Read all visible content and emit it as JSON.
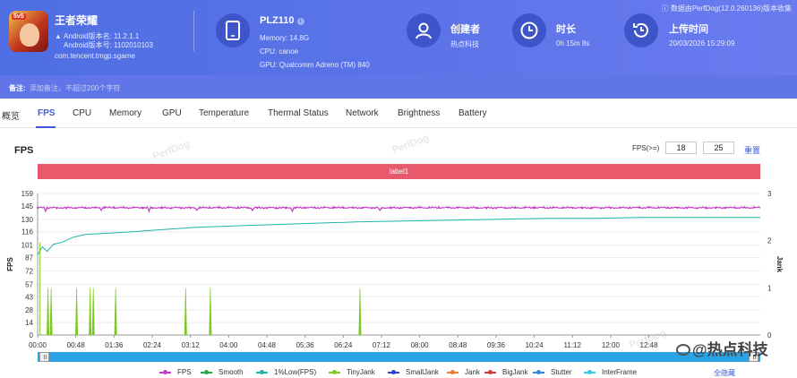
{
  "header": {
    "app": {
      "name": "王者荣耀",
      "badge": "5v5",
      "version_line": "Android版本名: 11.2.1.1",
      "code_line": "Android版本号: 1102010103",
      "package": "com.tencent.tmgp.sgame"
    },
    "device": {
      "name": "PLZ110",
      "info_icon": "i",
      "memory": "Memory: 14.8G",
      "cpu": "CPU: canoe",
      "gpu": "GPU: Qualcomm Adreno (TM) 840"
    },
    "creator": {
      "title": "创建者",
      "value": "热点科技"
    },
    "duration": {
      "title": "时长",
      "value": "0h 15m 8s"
    },
    "upload": {
      "title": "上传时间",
      "value": "20/03/2026 15:29:09"
    },
    "top_note": "ⓘ 数据由PerfDog(12.0.260136)版本收集"
  },
  "note": {
    "label": "备注:",
    "placeholder": "添加备注，不超过200个字符"
  },
  "tabs": [
    "概览",
    "FPS",
    "CPU",
    "Memory",
    "GPU",
    "Temperature",
    "Thermal Status",
    "Network",
    "Brightness",
    "Battery"
  ],
  "active_tab": "FPS",
  "fps_panel": {
    "title": "FPS",
    "threshold_label": "FPS(>=)",
    "threshold_value_1": "18",
    "threshold_value_2": "25",
    "reset_label": "重置",
    "range_label": "label1",
    "watermark": "PerfDog",
    "collapse_label": "全隐藏",
    "corner_watermark": "@热点科技"
  },
  "colors": {
    "header_bg": "#5b73e8",
    "accent": "#3a5ad8",
    "label_bar": "#e8596b",
    "fps": "#c43cc4",
    "low1": "#1fb5a8",
    "tinyjank": "#7bc820",
    "slider": "#29a3e6"
  },
  "chart_data": {
    "type": "line",
    "title": "FPS",
    "xlabel": "",
    "ylabel": "FPS",
    "y2label": "Jank",
    "ylim": [
      0,
      159
    ],
    "y2lim": [
      0,
      3
    ],
    "y_ticks": [
      0,
      14,
      28,
      43,
      57,
      72,
      87,
      101,
      116,
      130,
      145,
      159
    ],
    "y2_ticks": [
      0,
      1,
      2,
      3
    ],
    "x_ticks": [
      "00:00",
      "00:48",
      "01:36",
      "02:24",
      "03:12",
      "04:00",
      "04:48",
      "05:36",
      "06:24",
      "07:12",
      "08:00",
      "08:48",
      "09:36",
      "10:24",
      "11:12",
      "12:00",
      "12:48"
    ],
    "x_range_seconds": [
      0,
      908
    ],
    "fps_series": {
      "name": "FPS",
      "level": 143,
      "dips": [
        [
          10,
          139
        ],
        [
          80,
          140
        ],
        [
          140,
          139
        ],
        [
          200,
          140
        ],
        [
          270,
          140
        ],
        [
          320,
          139
        ],
        [
          430,
          140
        ]
      ]
    },
    "low1_series": {
      "name": "1%Low(FPS)",
      "points": [
        [
          0,
          90
        ],
        [
          6,
          99
        ],
        [
          12,
          94
        ],
        [
          20,
          102
        ],
        [
          30,
          104
        ],
        [
          45,
          110
        ],
        [
          60,
          113
        ],
        [
          80,
          114
        ],
        [
          100,
          115
        ],
        [
          120,
          116
        ],
        [
          150,
          118
        ],
        [
          200,
          121
        ],
        [
          260,
          123
        ],
        [
          330,
          125
        ],
        [
          400,
          127
        ],
        [
          460,
          128
        ],
        [
          520,
          129
        ],
        [
          580,
          130
        ],
        [
          640,
          131
        ],
        [
          700,
          131
        ],
        [
          760,
          132
        ],
        [
          820,
          132
        ],
        [
          880,
          132
        ],
        [
          908,
          132
        ]
      ]
    },
    "tinyjank_events": [
      {
        "t": 13,
        "value": 1
      },
      {
        "t": 17,
        "value": 1
      },
      {
        "t": 49,
        "value": 1
      },
      {
        "t": 66,
        "value": 1
      },
      {
        "t": 70,
        "value": 1
      },
      {
        "t": 98,
        "value": 1
      },
      {
        "t": 186,
        "value": 1
      },
      {
        "t": 217,
        "value": 1
      },
      {
        "t": 405,
        "value": 1
      }
    ],
    "legend": [
      {
        "name": "FPS",
        "color": "#c43cc4"
      },
      {
        "name": "Smooth",
        "color": "#27a84a"
      },
      {
        "name": "1%Low(FPS)",
        "color": "#1fb5a8"
      },
      {
        "name": "TinyJank",
        "color": "#7bc820"
      },
      {
        "name": "SmallJank",
        "color": "#2c3fd6"
      },
      {
        "name": "Jank",
        "color": "#f07c2a"
      },
      {
        "name": "BigJank",
        "color": "#d83a3a"
      },
      {
        "name": "Stutter",
        "color": "#3a85e6"
      },
      {
        "name": "InterFrame",
        "color": "#38c8e6"
      }
    ],
    "legend_position": "bottom",
    "grid": true
  }
}
